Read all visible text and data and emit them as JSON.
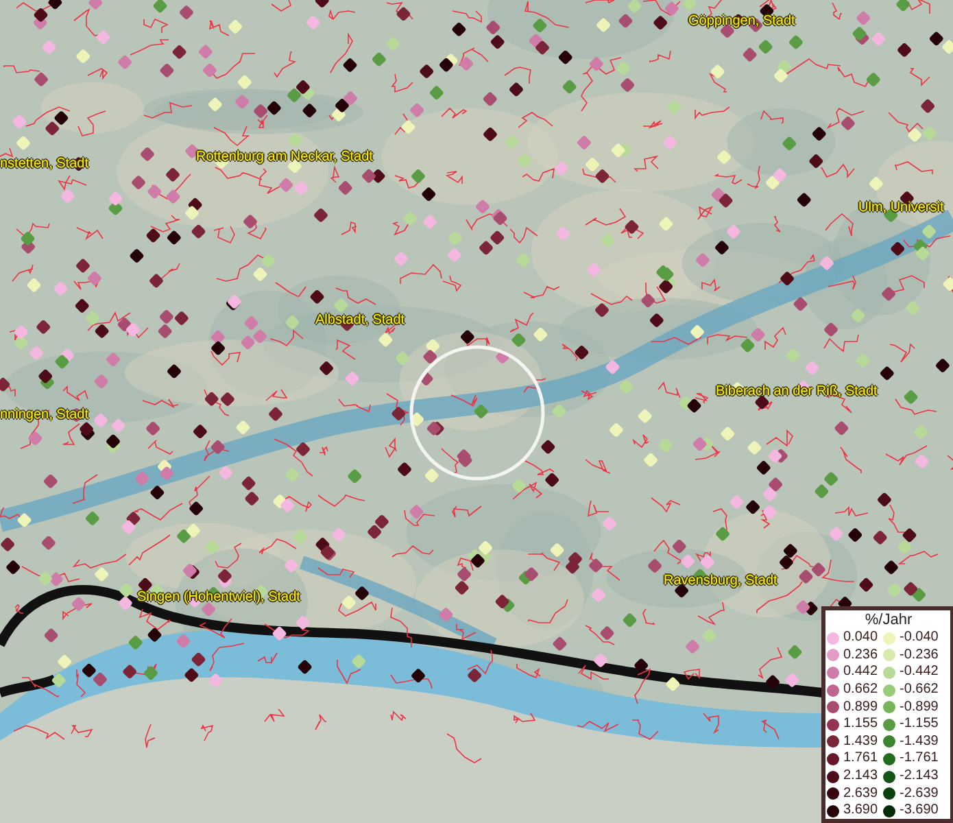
{
  "map": {
    "place_labels": [
      {
        "text": "Göppingen, Stadt"
      },
      {
        "text": "nstetten, Stadt"
      },
      {
        "text": "Rottenburg am Neckar, Stadt"
      },
      {
        "text": "Ulm, Universit"
      },
      {
        "text": "Albstadt, Stadt"
      },
      {
        "text": "nningen, Stadt"
      },
      {
        "text": "Biberach an der Riß, Stadt"
      },
      {
        "text": "Singen (Hohentwiel), Stadt"
      },
      {
        "text": "Ravensburg, Stadt"
      }
    ]
  },
  "legend": {
    "title": "%/Jahr",
    "positive": [
      {
        "value": "0.040",
        "color": "#f4b8e0"
      },
      {
        "value": "0.236",
        "color": "#e49cc6"
      },
      {
        "value": "0.442",
        "color": "#d07ca8"
      },
      {
        "value": "0.662",
        "color": "#bf6690"
      },
      {
        "value": "0.899",
        "color": "#a84c70"
      },
      {
        "value": "1.155",
        "color": "#943450"
      },
      {
        "value": "1.439",
        "color": "#7c2438"
      },
      {
        "value": "1.761",
        "color": "#681628"
      },
      {
        "value": "2.143",
        "color": "#4e0c18"
      },
      {
        "value": "2.639",
        "color": "#3a0610"
      },
      {
        "value": "3.690",
        "color": "#240208"
      }
    ],
    "negative": [
      {
        "value": "-0.040",
        "color": "#eef4b8"
      },
      {
        "value": "-0.236",
        "color": "#d6eaae"
      },
      {
        "value": "-0.442",
        "color": "#b8da98"
      },
      {
        "value": "-0.662",
        "color": "#98ca78"
      },
      {
        "value": "-0.899",
        "color": "#78b458"
      },
      {
        "value": "-1.155",
        "color": "#5a9c44"
      },
      {
        "value": "-1.439",
        "color": "#3c8430"
      },
      {
        "value": "-1.761",
        "color": "#246c20"
      },
      {
        "value": "-2.143",
        "color": "#145414"
      },
      {
        "value": "-2.639",
        "color": "#0a400c"
      },
      {
        "value": "-3.690",
        "color": "#042c04"
      }
    ]
  }
}
